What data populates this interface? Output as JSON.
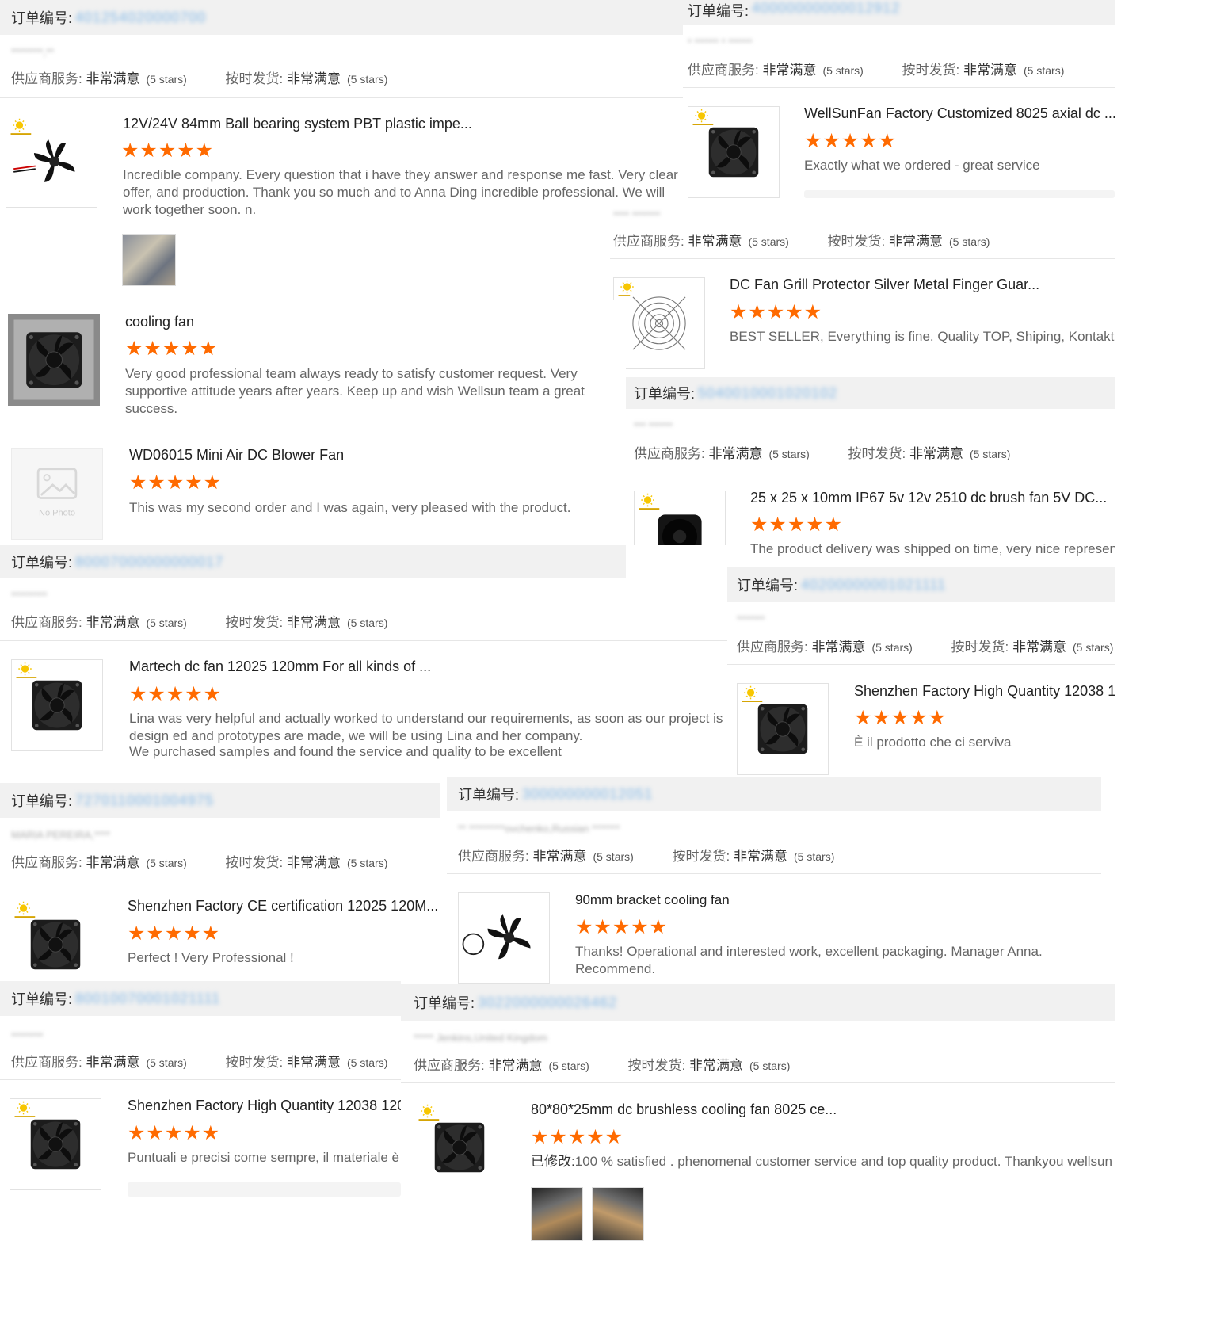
{
  "ui": {
    "order_label": "订单编号:",
    "service_label": "供应商服务:",
    "ship_label": "按时发货:",
    "rating_value": "非常满意",
    "rating_stars": "(5 stars)",
    "stars": "★★★★★",
    "modified_label": "已修改:",
    "no_photo": "No Photo",
    "accent_color": "#ff6a00",
    "link_color": "#7fb6e6"
  },
  "panels": [
    {
      "order_no": "401254020000700",
      "buyer": "********,**",
      "product": "12V/24V 84mm Ball bearing system PBT plastic impe...",
      "comment": "Incredible company. Every question that i have they answer and response me fast. Very clear offer, and production. Thank you so much and to Anna Ding incredible professional. We will work together soon. n."
    },
    {
      "order_no": "40000000000012912",
      "buyer": "* ****** * ******",
      "product": "WellSunFan Factory Customized 8025 axial dc ...",
      "comment": "Exactly what we ordered - great service"
    },
    {
      "buyer": "**** *******",
      "product": "DC Fan Grill Protector Silver Metal Finger Guar...",
      "comment": "BEST SELLER, Everything is fine. Quality TOP, Shiping, Kontakt GOOD."
    },
    {
      "product": "cooling fan",
      "comment": "Very good professional team always ready to satisfy customer request. Very supportive attitude years after years. Keep up and wish Wellsun team a great success."
    },
    {
      "order_no": "5040010001020102",
      "buyer": "*** ******",
      "product": "25 x 25 x 10mm IP67 5v 12v 2510 dc brush fan 5V DC...",
      "comment": "The product delivery was shipped on time, very nice representative"
    },
    {
      "product": "WD06015 Mini Air DC Blower Fan",
      "comment": "This was my second order and I was again, very pleased with the product."
    },
    {
      "order_no": "40200000001021111",
      "buyer": "*******",
      "product": "Shenzhen Factory High Quantity 12038 1",
      "comment": "È il prodotto che ci serviva"
    },
    {
      "order_no": "80007000000000017",
      "buyer": "*********",
      "product": "Martech dc fan 12025 120mm For all kinds of ...",
      "comment": "Lina was very helpful and actually worked to understand our requirements, as soon as our project is design ed and prototypes are made, we will be using Lina and her company.",
      "comment2": "We purchased samples and found the service and quality to be excellent"
    },
    {
      "order_no": "7270110001004975",
      "buyer": "MARIA PEREIRA,****",
      "product": "Shenzhen Factory CE certification 12025 120M...",
      "comment": "Perfect ! Very Professional !"
    },
    {
      "order_no": "300000000012051",
      "buyer": "** *********ovchenko,Russian *******",
      "product": "90mm bracket cooling fan",
      "comment": "Thanks! Operational and interested work, excellent packaging. Manager Anna. Recommend."
    },
    {
      "order_no": "80010070001021111",
      "buyer": "********",
      "product": "Shenzhen Factory High Quantity 12038 120",
      "comment": "Puntuali e precisi come sempre, il materiale è qu"
    },
    {
      "order_no": "3022000000026462",
      "buyer": "***** Jenkins,United Kingdom",
      "product": "80*80*25mm dc brushless cooling fan 8025 ce...",
      "comment": "100 % satisfied . phenomenal customer service and top quality product. Thankyou wellsun"
    }
  ]
}
